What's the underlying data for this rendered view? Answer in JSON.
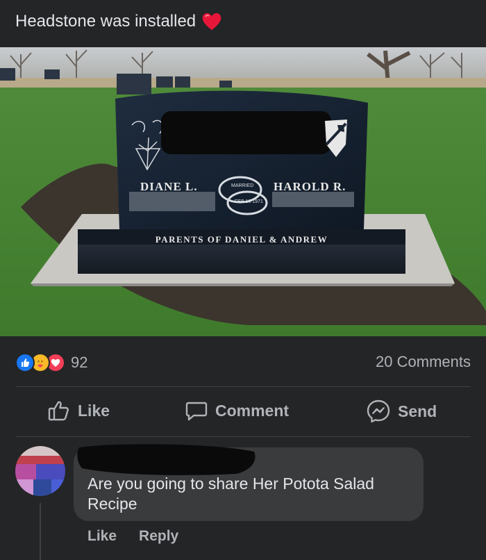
{
  "post": {
    "text": "Headstone was installed",
    "emoji": "red-heart"
  },
  "headstone": {
    "left_name": "DIANE L.",
    "right_name": "HAROLD R.",
    "ring_text_top": "MARRIED",
    "ring_text_bottom": "FEB 16 1971",
    "base_text": "PARENTS OF DANIEL & ANDREW"
  },
  "stats": {
    "reactions": [
      "like-icon",
      "care-icon",
      "love-icon"
    ],
    "reaction_count": "92",
    "comment_count": "20 Comments"
  },
  "actions": {
    "like": "Like",
    "comment": "Comment",
    "send": "Send"
  },
  "comment": {
    "text": "Are you going to share Her Potota Salad Recipe",
    "like": "Like",
    "reply": "Reply"
  },
  "colors": {
    "background": "#242526",
    "bubble": "#3a3b3c",
    "text_primary": "#e4e6eb",
    "text_secondary": "#b0b3b8",
    "like_blue": "#1877f2",
    "love_red": "#f33e58",
    "care_yellow": "#f7b928"
  }
}
